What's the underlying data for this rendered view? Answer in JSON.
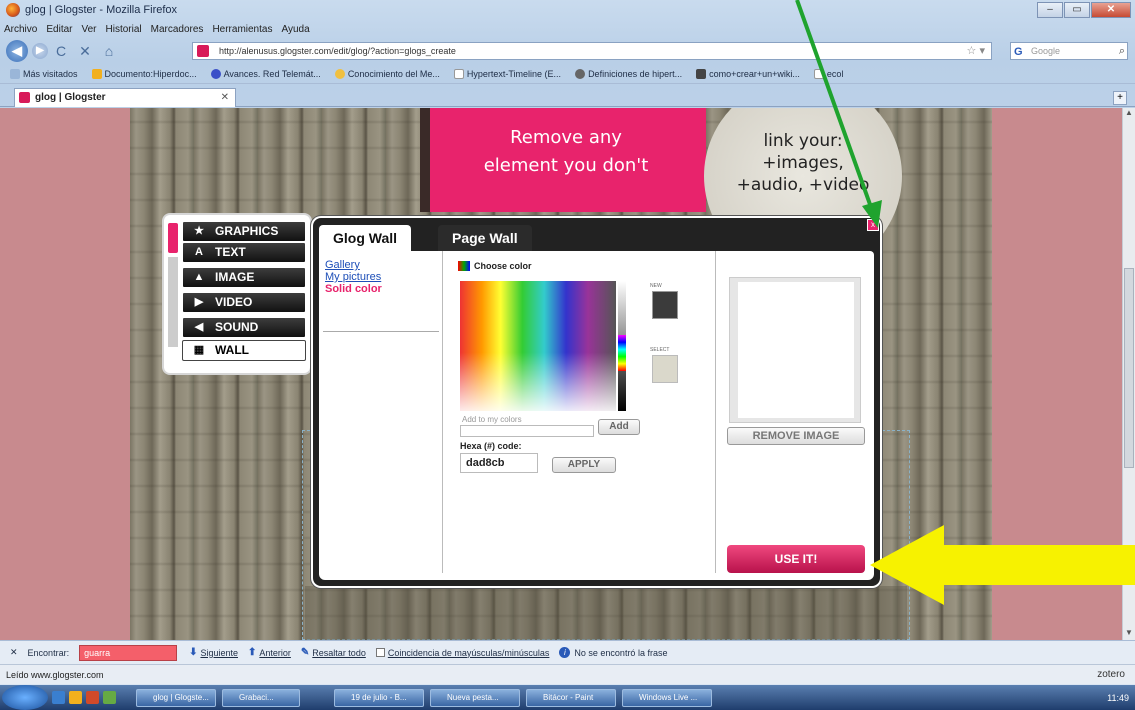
{
  "window": {
    "title": "glog | Glogster - Mozilla Firefox",
    "min": "–",
    "max": "▭",
    "close": "✕"
  },
  "menu": [
    "Archivo",
    "Editar",
    "Ver",
    "Historial",
    "Marcadores",
    "Herramientas",
    "Ayuda"
  ],
  "nav": {
    "back": "◀",
    "forward": "▶",
    "reload": "C",
    "stop": "✕",
    "home": "⌂",
    "url": "http://alenusus.glogster.com/edit/glog/?action=glogs_create",
    "search_placeholder": "Google"
  },
  "bookmarks": [
    "Más visitados",
    "Documento:Hiperdoc...",
    "Avances. Red Telemát...",
    "Conocimiento del Me...",
    "Hypertext-Timeline (E...",
    "Definiciones de hipert...",
    "como+crear+un+wiki...",
    "ecol"
  ],
  "tab": {
    "label": "glog | Glogster",
    "close": "✕",
    "new": "+"
  },
  "page": {
    "banner_line1": "Remove any",
    "banner_line2": "element you don't",
    "circle_line1": "link your:",
    "circle_line2": "+images,",
    "circle_line3": "+audio, +video"
  },
  "toolbox": {
    "items": [
      {
        "label": "GRAPHICS",
        "icon": "★"
      },
      {
        "label": "TEXT",
        "icon": "A"
      },
      {
        "label": "IMAGE",
        "icon": "▲"
      },
      {
        "label": "VIDEO",
        "icon": "▶"
      },
      {
        "label": "SOUND",
        "icon": "◀"
      },
      {
        "label": "WALL",
        "icon": "▦"
      }
    ]
  },
  "modal": {
    "tab_glog_wall": "Glog Wall",
    "tab_page_wall": "Page Wall",
    "close": "x",
    "links": {
      "gallery": "Gallery",
      "my_pictures": "My pictures",
      "solid_color": "Solid color"
    },
    "choose_color": "Choose color",
    "new_label": "NEW",
    "select_label": "SELECT",
    "add_label": "Add to my colors",
    "add_button": "Add",
    "hexa_label": "Hexa (#) code:",
    "hexa_value": "dad8cb",
    "apply_button": "APPLY",
    "remove_image_button": "REMOVE IMAGE",
    "use_it_button": "USE IT!"
  },
  "find": {
    "close": "✕",
    "label": "Encontrar:",
    "value": "guarra",
    "next": "Siguiente",
    "prev": "Anterior",
    "highlight": "Resaltar todo",
    "match_case": "Coincidencia de mayúsculas/minúsculas",
    "not_found": "No se encontró la frase"
  },
  "status": {
    "text": "Leído www.glogster.com",
    "zotero": "zotero"
  },
  "taskbar": {
    "items": [
      "glog | Glogste...",
      "Grabaci...",
      "19 de julio - B...",
      "Nueva pesta...",
      "Bitácor - Paint",
      "Windows Live ..."
    ],
    "time": "11:49"
  },
  "colors": {
    "accent_pink": "#e8236c",
    "selected_swatch": "#dad8cb",
    "arrow_green": "#1fa32e",
    "arrow_yellow": "#f7f200"
  }
}
